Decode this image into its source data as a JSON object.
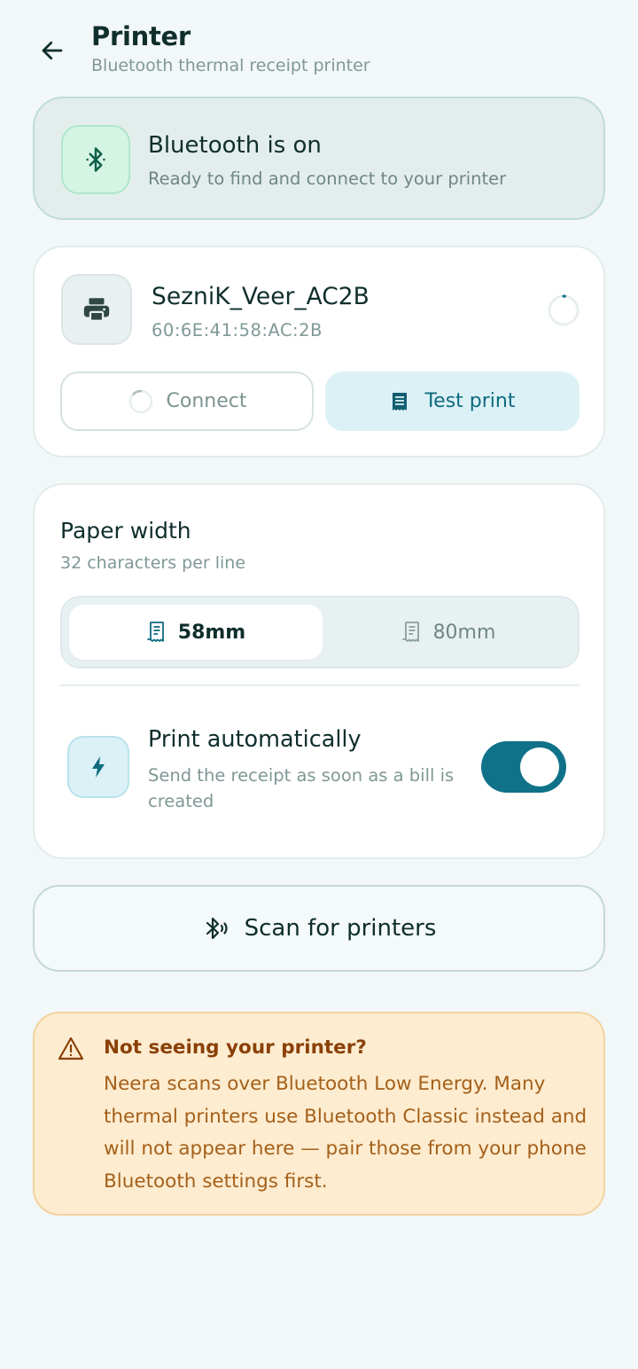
{
  "header": {
    "title": "Printer",
    "subtitle": "Bluetooth thermal receipt printer",
    "back_icon": "arrow-left-icon"
  },
  "bluetooth_status": {
    "icon": "bluetooth-icon",
    "title": "Bluetooth is on",
    "subtitle": "Ready to find and connect to your printer"
  },
  "device": {
    "icon": "printer-icon",
    "name": "SezniK_Veer_AC2B",
    "mac": "60:6E:41:58:AC:2B",
    "connect_label": "Connect",
    "test_print_label": "Test print",
    "test_print_icon": "receipt-icon"
  },
  "paper_width": {
    "title": "Paper width",
    "subtitle": "32 characters per line",
    "options": [
      {
        "label": "58mm",
        "selected": true,
        "icon": "receipt-icon"
      },
      {
        "label": "80mm",
        "selected": false,
        "icon": "receipt-icon"
      }
    ]
  },
  "auto_print": {
    "icon": "lightning-icon",
    "title": "Print automatically",
    "subtitle": "Send the receipt as soon as a bill is created",
    "enabled": true
  },
  "scan": {
    "icon": "bluetooth-searching-icon",
    "label": "Scan for printers"
  },
  "warning": {
    "icon": "warning-triangle-icon",
    "title": "Not seeing your printer?",
    "body": "Neera scans over Bluetooth Low Energy. Many thermal printers use Bluetooth Classic instead and will not appear here — pair those from your phone Bluetooth settings first."
  },
  "colors": {
    "background": "#f2f7f8",
    "accent": "#0f7289",
    "bluetooth_green": "#0f6b4f",
    "warning_bg": "#fdecd0",
    "warning_text": "#8a4006"
  }
}
